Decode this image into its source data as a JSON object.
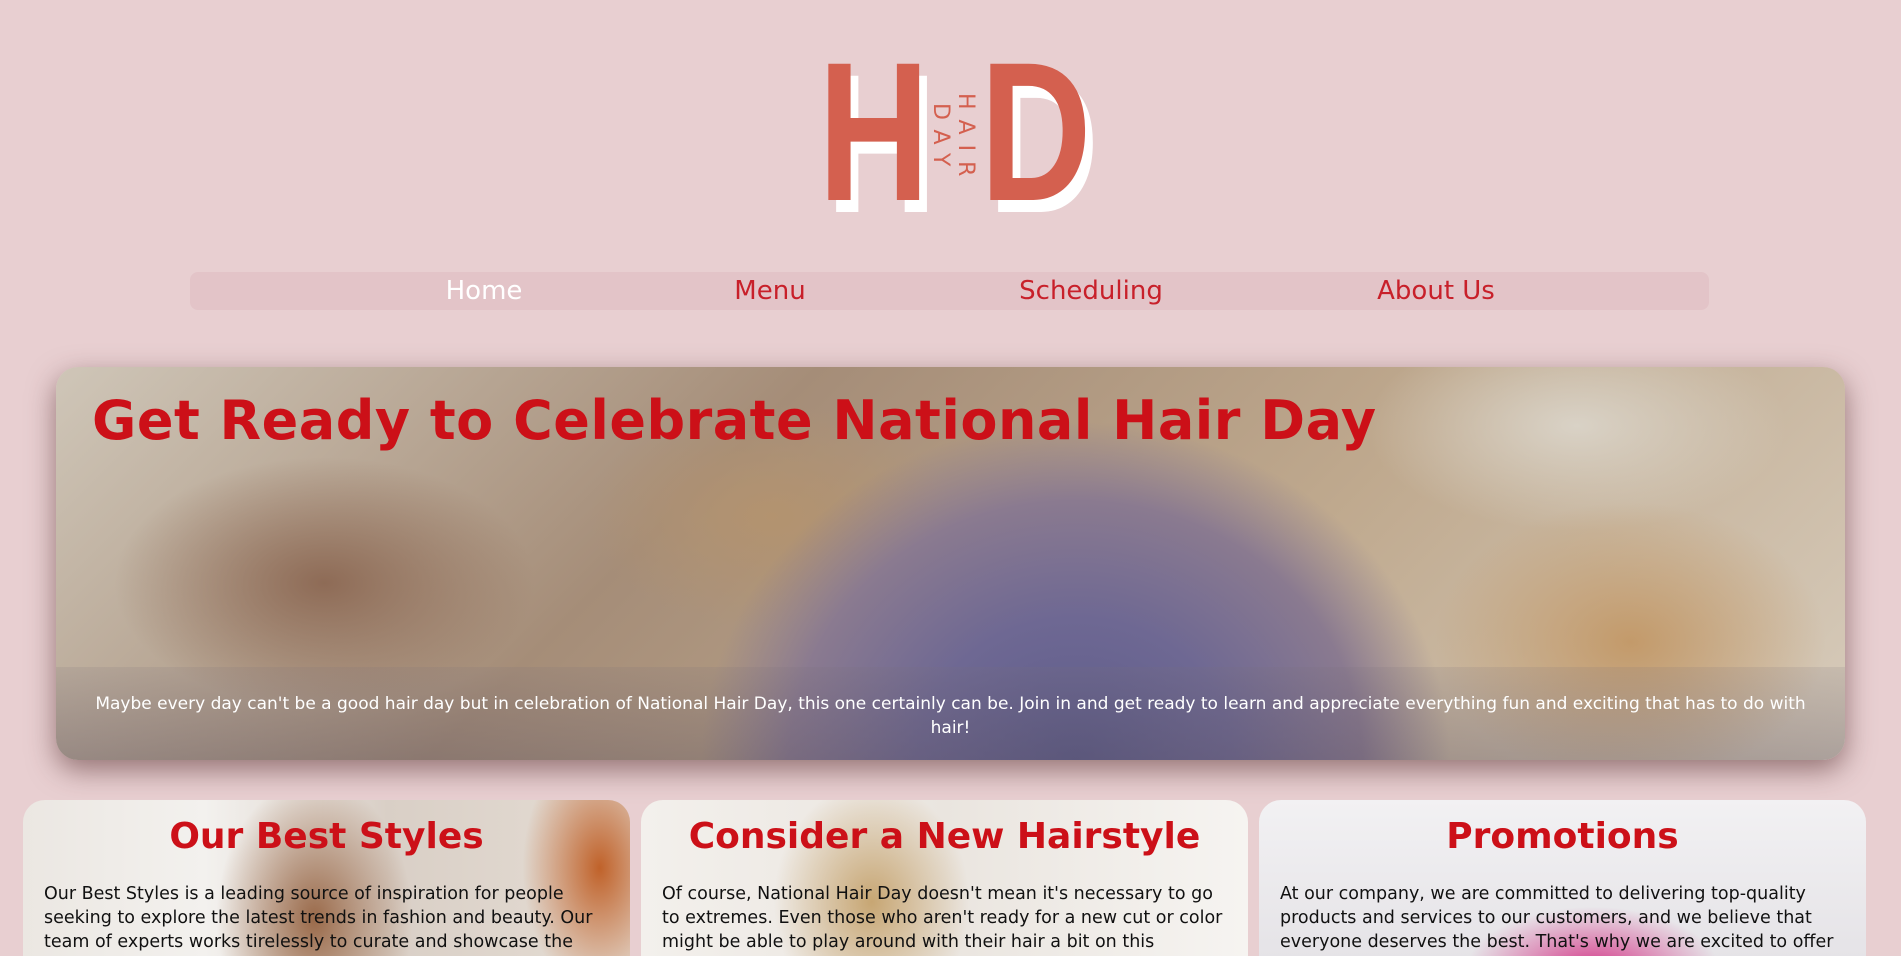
{
  "logo": {
    "letter_left": "H",
    "letter_right": "D",
    "tagline": "HAIR DAY"
  },
  "nav": {
    "items": [
      {
        "label": "Home",
        "active": true
      },
      {
        "label": "Menu",
        "active": false
      },
      {
        "label": "Scheduling",
        "active": false
      },
      {
        "label": "About Us",
        "active": false
      }
    ]
  },
  "hero": {
    "title": "Get Ready to Celebrate National Hair Day",
    "caption": "Maybe every day can't be a good hair day but in celebration of National Hair Day, this one certainly can be. Join in and get ready to learn and appreciate everything fun and exciting that has to do with hair!"
  },
  "cards": [
    {
      "title": "Our Best Styles",
      "text": "Our Best Styles is a leading source of inspiration for people seeking to explore the latest trends in fashion and beauty. Our team of experts works tirelessly to curate and showcase the"
    },
    {
      "title": "Consider a New Hairstyle",
      "text": "Of course, National Hair Day doesn't mean it's necessary to go to extremes. Even those who aren't ready for a new cut or color might be able to play around with their hair a bit on this"
    },
    {
      "title": "Promotions",
      "text": "At our company, we are committed to delivering top-quality products and services to our customers, and we believe that everyone deserves the best. That's why we are excited to offer"
    }
  ],
  "colors": {
    "background": "#e8cfd1",
    "accent": "#cc1018",
    "logo": "#d4604f",
    "nav_bar": "#e3c4c8"
  }
}
